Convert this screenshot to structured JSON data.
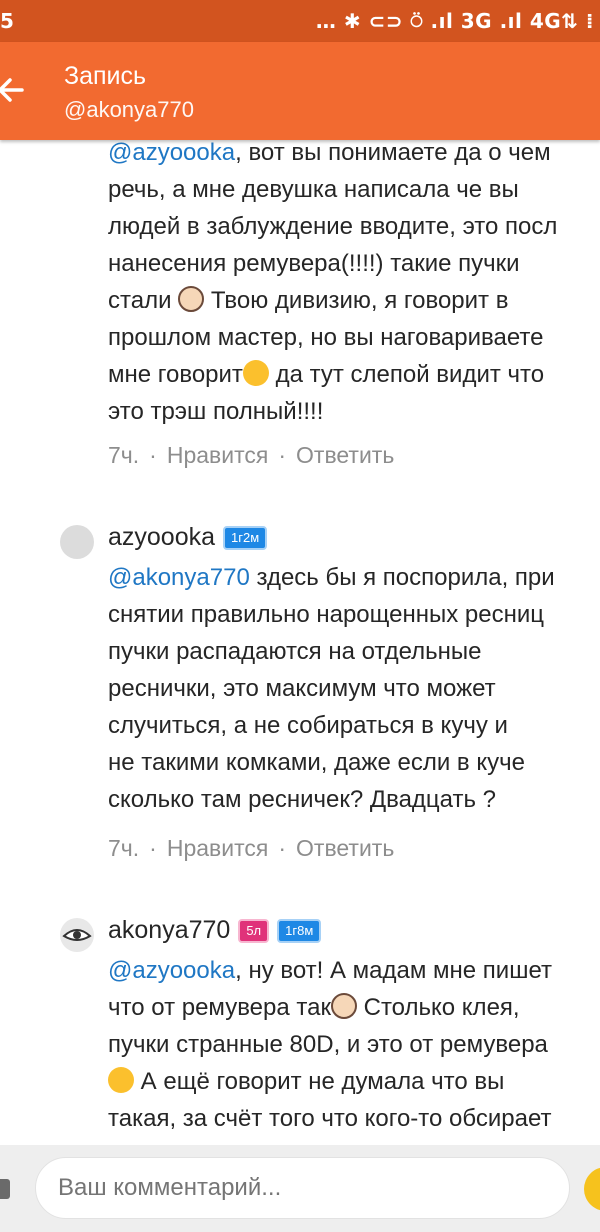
{
  "status_bar": {
    "time_fragment": "5",
    "indicators": "… ✱ ⊂⊃ ⍥ .ıl 3G .ıl 4G⇅ ⁞"
  },
  "header": {
    "title": "Запись",
    "subtitle": "@akonya770"
  },
  "comments": [
    {
      "lines": [
        {
          "mention": "@azyoooka",
          "text": ", вот вы понимаете да о чем"
        },
        {
          "text": "речь, а мне девушка написала че вы"
        },
        {
          "text": "людей в заблуждение вводите, это посл"
        },
        {
          "text": "нанесения ремувера(!!!!) такие пучки"
        },
        {
          "text": "стали",
          "emoji": "facepalm-emoji",
          "text2": " Твою дивизию, я говорит в"
        },
        {
          "text": "прошлом мастер, но вы наговариваете"
        },
        {
          "text": "мне говорит",
          "emoji": "grin-emoji",
          "text2": " да тут слепой видит что"
        },
        {
          "text": "это трэш полный!!!!"
        }
      ],
      "time": "7ч.",
      "like": "Нравится",
      "reply": "Ответить"
    },
    {
      "author": "azyoooka",
      "badges": [
        {
          "text": "1г2м",
          "color": "#1e88e5"
        }
      ],
      "lines": [
        {
          "mention": "@akonya770",
          "text": " здесь бы я поспорила, при"
        },
        {
          "text": "снятии правильно нарощенных ресниц"
        },
        {
          "text": "пучки распадаются на отдельные"
        },
        {
          "text": "реснички, это максимум что может"
        },
        {
          "text": "случиться, а не собираться в кучу и"
        },
        {
          "text": "не такими комками, даже если в куче"
        },
        {
          "text": "сколько там ресничек? Двадцать ?"
        }
      ],
      "time": "7ч.",
      "like": "Нравится",
      "reply": "Ответить"
    },
    {
      "author": "akonya770",
      "badges": [
        {
          "text": "5л",
          "color": "#e0327a"
        },
        {
          "text": "1г8м",
          "color": "#1e88e5"
        }
      ],
      "lines": [
        {
          "mention": "@azyoooka",
          "text": ", ну вот! А мадам мне пишет"
        },
        {
          "text": "что от ремувера так",
          "emoji": "facepalm-emoji",
          "text2": " Столько клея,"
        },
        {
          "text": "пучки странные 80D, и это от ремувера"
        },
        {
          "emoji": "laughing-emoji",
          "text2": " А ещё говорит не думала что вы"
        },
        {
          "text": "такая, за счёт того что кого-то обсирает"
        }
      ]
    }
  ],
  "input": {
    "placeholder": "Ваш комментарий..."
  },
  "colors": {
    "status_bar": "#d2541f",
    "app_bar": "#f26a30",
    "mention": "#1f77c4",
    "badge_blue": "#1e88e5",
    "badge_pink": "#e0327a"
  }
}
